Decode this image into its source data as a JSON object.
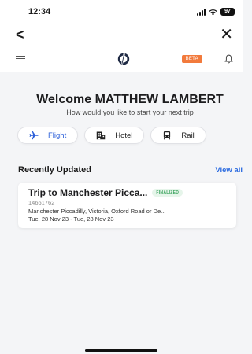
{
  "status_bar": {
    "time": "12:34",
    "battery": "97"
  },
  "nav": {
    "back_icon": "back-arrow-icon",
    "close_icon": "close-icon"
  },
  "header": {
    "menu_icon": "hamburger-menu-icon",
    "logo_icon": "brand-logo-icon",
    "beta_label": "BETA",
    "bell_icon": "notification-bell-icon"
  },
  "welcome": {
    "title": "Welcome MATTHEW LAMBERT",
    "subtitle": "How would you like to start your next trip"
  },
  "modes": [
    {
      "label": "Flight",
      "icon": "airplane-icon"
    },
    {
      "label": "Hotel",
      "icon": "hotel-icon"
    },
    {
      "label": "Rail",
      "icon": "train-icon"
    }
  ],
  "recent": {
    "title": "Recently Updated",
    "view_all": "View all",
    "trips": [
      {
        "title": "Trip to Manchester Picca...",
        "status": "FINALIZED",
        "reference": "14661762",
        "route": "Manchester Piccadilly, Victoria, Oxford Road or De...",
        "dates": "Tue, 28 Nov 23 - Tue, 28 Nov 23"
      }
    ]
  },
  "colors": {
    "accent_blue": "#2b6be0",
    "beta_orange": "#f27a3c",
    "finalized_green": "#3aa35d",
    "background": "#f4f5f7"
  }
}
